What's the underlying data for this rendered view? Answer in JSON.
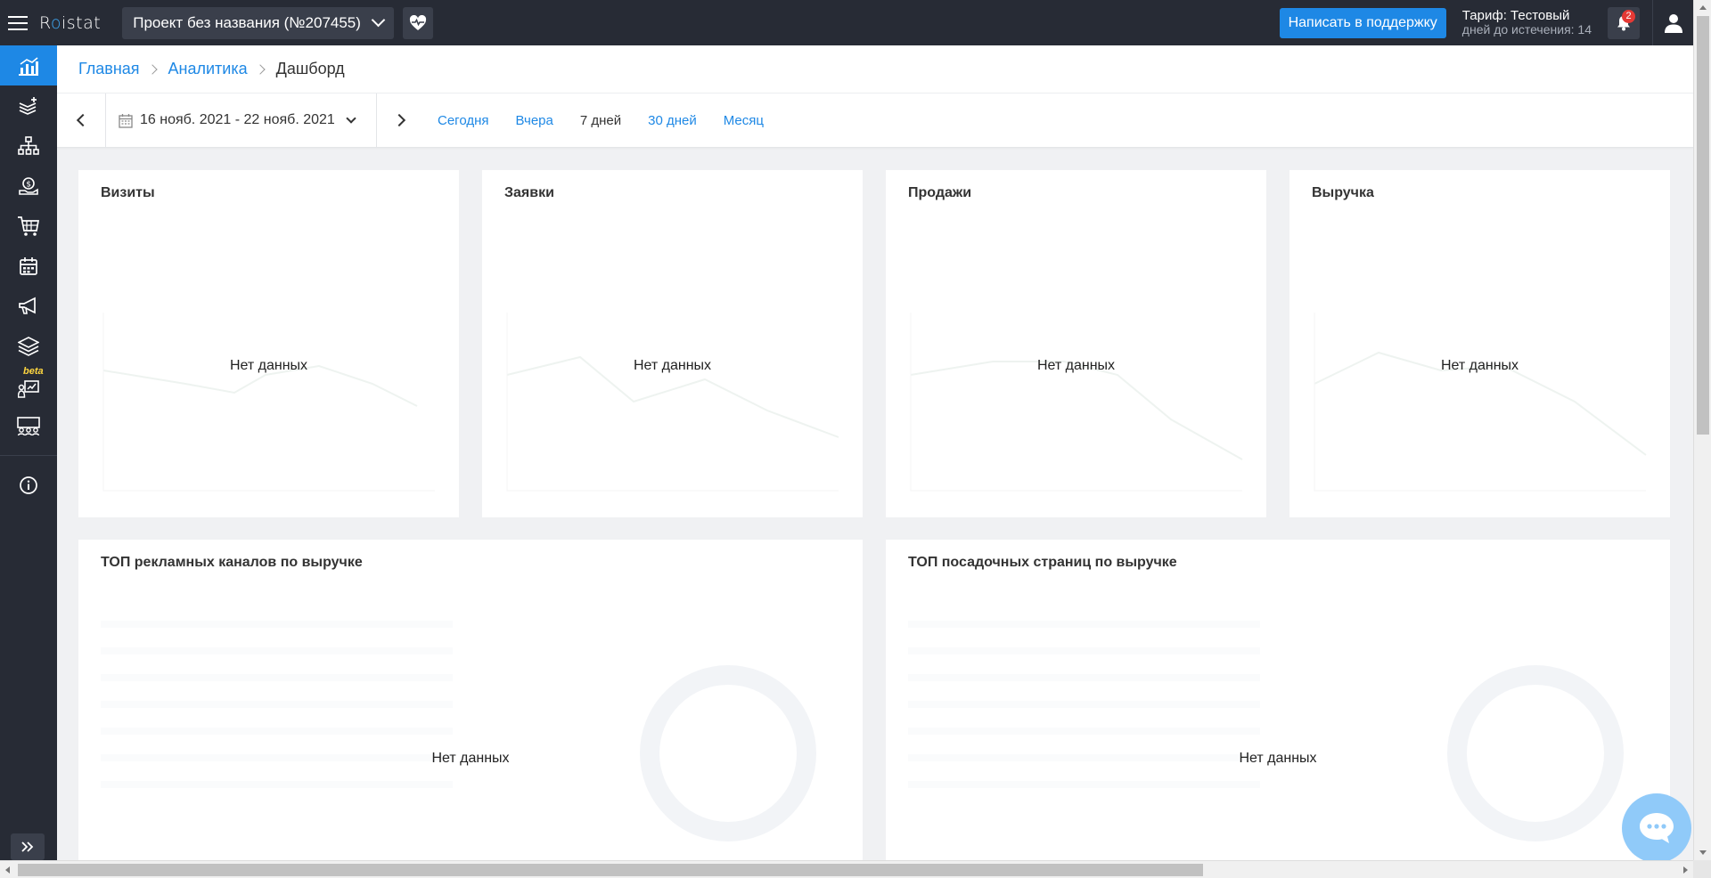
{
  "header": {
    "logo": {
      "pre": "R",
      "dot": "o",
      "post": "istat"
    },
    "project": "Проект без названия (№207455)",
    "support_button": "Написать в поддержку",
    "tariff_line1": "Тариф: Тестовый",
    "tariff_line2": "дней до истечения: 14",
    "notification_count": "2"
  },
  "sidebar": {
    "beta_label": "beta"
  },
  "breadcrumb": {
    "items": [
      "Главная",
      "Аналитика"
    ],
    "current": "Дашборд"
  },
  "datebar": {
    "range": "16 нояб. 2021 - 22 нояб. 2021",
    "periods": [
      "Сегодня",
      "Вчера",
      "7 дней",
      "30 дней",
      "Месяц"
    ]
  },
  "cards": [
    {
      "title": "Визиты",
      "nodata": "Нет данных"
    },
    {
      "title": "Заявки",
      "nodata": "Нет данных"
    },
    {
      "title": "Продажи",
      "nodata": "Нет данных"
    },
    {
      "title": "Выручка",
      "nodata": "Нет данных"
    }
  ],
  "wide_cards": [
    {
      "title": "ТОП рекламных каналов по выручке",
      "nodata": "Нет данных"
    },
    {
      "title": "ТОП посадочных страниц по выручке",
      "nodata": "Нет данных"
    }
  ],
  "colors": {
    "topbar": "#272b35",
    "accent": "#1e88e5",
    "badge": "#e53935",
    "beta": "#ffd740"
  }
}
